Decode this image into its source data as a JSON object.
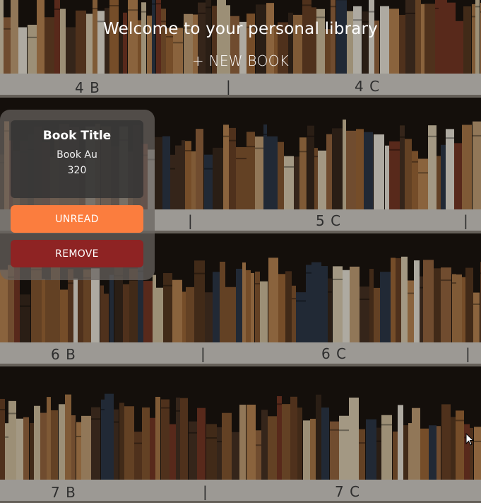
{
  "header": {
    "title": "Welcome to your personal library",
    "new_book_label": "+ NEW BOOK"
  },
  "book_card": {
    "title": "Book Title",
    "author": "Book Au",
    "pages": "320",
    "status_button_label": "UNREAD",
    "remove_button_label": "REMOVE"
  },
  "shelves": {
    "labels": [
      "4 B",
      "4 C",
      "5 C",
      "6 B",
      "6 C",
      "7 B",
      "7 C"
    ],
    "divider": "|"
  },
  "colors": {
    "unread_button": "#fb7d3e",
    "remove_button": "#8e2323",
    "card_background": "#69645f",
    "shelf_board": "#d9d4cd"
  },
  "icons": {
    "cursor": "mouse-pointer-icon"
  }
}
